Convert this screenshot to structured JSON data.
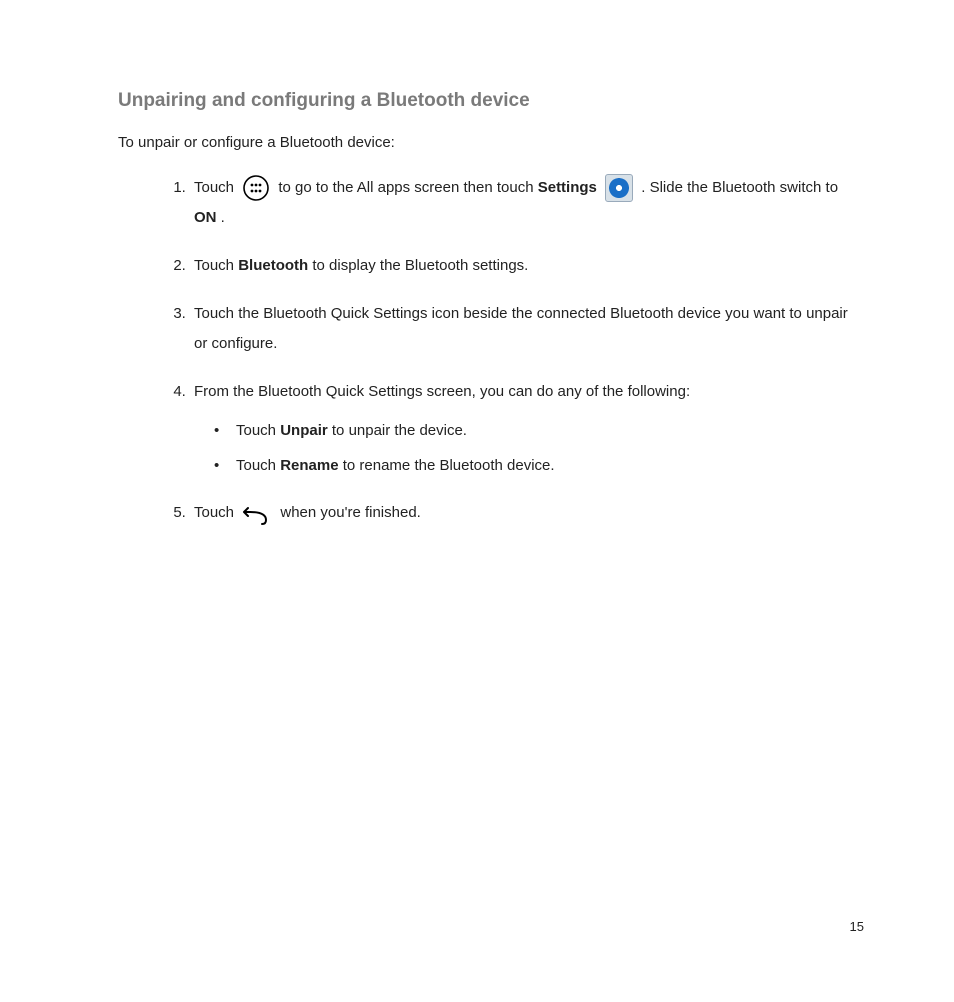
{
  "heading": "Unpairing and configuring a Bluetooth device",
  "intro": "To unpair or configure a Bluetooth device:",
  "steps": {
    "s1": {
      "t1": "Touch ",
      "t2": " to go to the All apps screen then touch ",
      "t3": "Settings",
      "t4": " . Slide the Bluetooth switch to ",
      "t5": "ON",
      "t6": "."
    },
    "s2": {
      "t1": "Touch ",
      "t2": "Bluetooth",
      "t3": " to display the Bluetooth settings."
    },
    "s3": "Touch the Bluetooth Quick Settings icon beside the connected Bluetooth device you want to unpair or configure.",
    "s4": {
      "intro": "From the Bluetooth Quick Settings screen, you can do any of the following:",
      "b1": {
        "t1": "Touch ",
        "t2": "Unpair",
        "t3": " to unpair the device."
      },
      "b2": {
        "t1": "Touch ",
        "t2": "Rename",
        "t3": " to rename the Bluetooth device."
      }
    },
    "s5": {
      "t1": "Touch ",
      "t2": " when you're finished."
    }
  },
  "pageNumber": "15"
}
